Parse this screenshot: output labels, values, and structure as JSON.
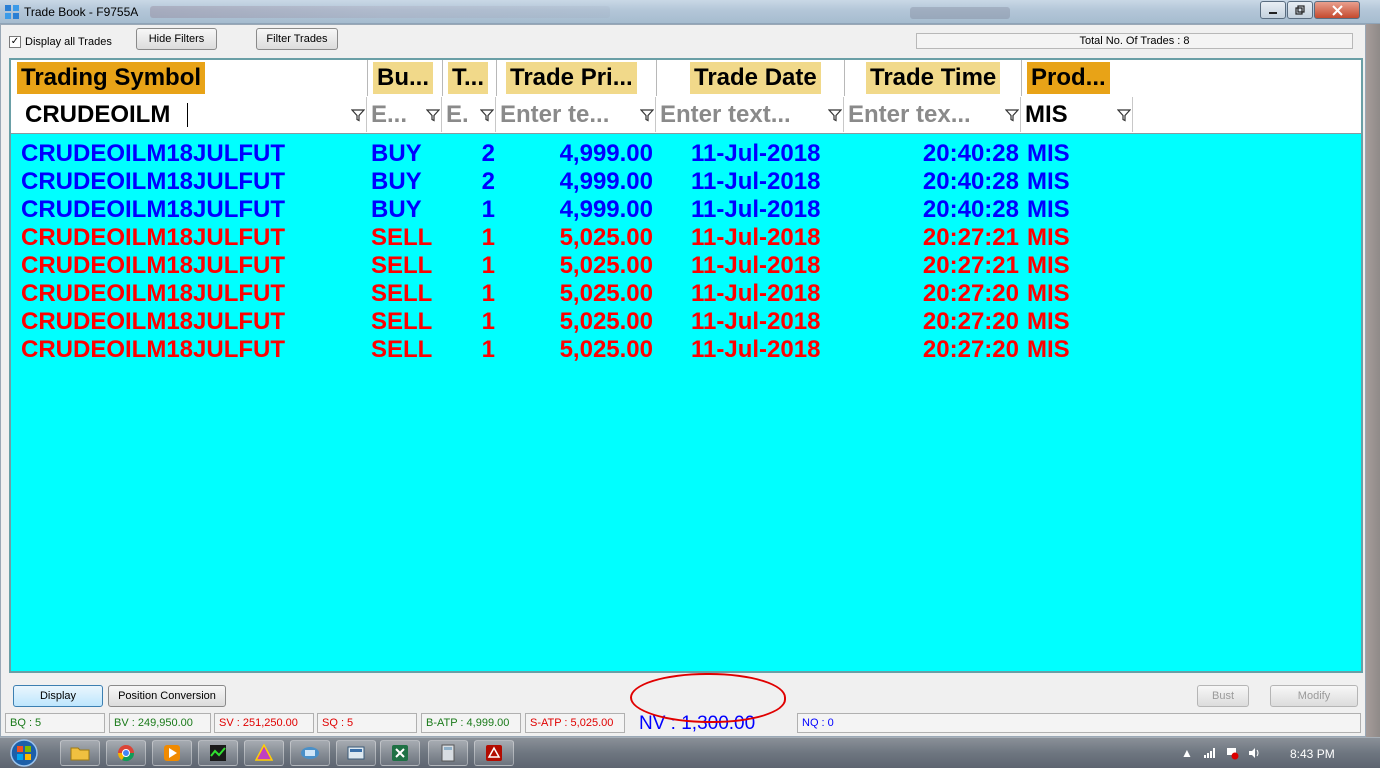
{
  "window": {
    "title": "Trade Book - F9755A"
  },
  "toolbar": {
    "display_all_label": "Display all Trades",
    "display_all_checked": true,
    "hide_filters_label": "Hide Filters",
    "filter_trades_label": "Filter Trades",
    "total_trades": "Total No. Of Trades : 8"
  },
  "grid": {
    "columns": [
      {
        "key": "symbol",
        "header": "Trading Symbol",
        "filter": "CRUDEOILM",
        "filter_is_value": true
      },
      {
        "key": "side",
        "header": "Bu...",
        "filter": "E...",
        "filter_is_value": false
      },
      {
        "key": "qty",
        "header": "T...",
        "filter": "E.",
        "filter_is_value": false
      },
      {
        "key": "price",
        "header": "Trade Pri...",
        "filter": "Enter te...",
        "filter_is_value": false
      },
      {
        "key": "date",
        "header": "Trade Date",
        "filter": "Enter text...",
        "filter_is_value": false
      },
      {
        "key": "time",
        "header": "Trade Time",
        "filter": "Enter tex...",
        "filter_is_value": false
      },
      {
        "key": "product",
        "header": "Prod...",
        "filter": "MIS",
        "filter_is_value": true
      }
    ],
    "rows": [
      {
        "symbol": "CRUDEOILM18JULFUT",
        "side": "BUY",
        "qty": "2",
        "price": "4,999.00",
        "date": "11-Jul-2018",
        "time": "20:40:28",
        "product": "MIS",
        "color": "#0000ff"
      },
      {
        "symbol": "CRUDEOILM18JULFUT",
        "side": "BUY",
        "qty": "2",
        "price": "4,999.00",
        "date": "11-Jul-2018",
        "time": "20:40:28",
        "product": "MIS",
        "color": "#0000ff"
      },
      {
        "symbol": "CRUDEOILM18JULFUT",
        "side": "BUY",
        "qty": "1",
        "price": "4,999.00",
        "date": "11-Jul-2018",
        "time": "20:40:28",
        "product": "MIS",
        "color": "#0000ff"
      },
      {
        "symbol": "CRUDEOILM18JULFUT",
        "side": "SELL",
        "qty": "1",
        "price": "5,025.00",
        "date": "11-Jul-2018",
        "time": "20:27:21",
        "product": "MIS",
        "color": "#ff0000"
      },
      {
        "symbol": "CRUDEOILM18JULFUT",
        "side": "SELL",
        "qty": "1",
        "price": "5,025.00",
        "date": "11-Jul-2018",
        "time": "20:27:21",
        "product": "MIS",
        "color": "#ff0000"
      },
      {
        "symbol": "CRUDEOILM18JULFUT",
        "side": "SELL",
        "qty": "1",
        "price": "5,025.00",
        "date": "11-Jul-2018",
        "time": "20:27:20",
        "product": "MIS",
        "color": "#ff0000"
      },
      {
        "symbol": "CRUDEOILM18JULFUT",
        "side": "SELL",
        "qty": "1",
        "price": "5,025.00",
        "date": "11-Jul-2018",
        "time": "20:27:20",
        "product": "MIS",
        "color": "#ff0000"
      },
      {
        "symbol": "CRUDEOILM18JULFUT",
        "side": "SELL",
        "qty": "1",
        "price": "5,025.00",
        "date": "11-Jul-2018",
        "time": "20:27:20",
        "product": "MIS",
        "color": "#ff0000"
      }
    ]
  },
  "bottom": {
    "display_label": "Display",
    "position_conversion_label": "Position Conversion",
    "bust_label": "Bust",
    "modify_label": "Modify"
  },
  "status": {
    "bq": "BQ : 5",
    "bv": "BV : 249,950.00",
    "sv": "SV : 251,250.00",
    "sq": "SQ : 5",
    "batp": "B-ATP : 4,999.00",
    "satp": "S-ATP : 5,025.00",
    "nv": "NV : 1,300.00",
    "nq": "NQ : 0"
  },
  "taskbar": {
    "clock": "8:43 PM"
  },
  "colors": {
    "grid_bg": "#00ffff",
    "header_highlight": "#e8a317",
    "header_light": "#f1d98a",
    "buy": "#0000ff",
    "sell": "#ff0000",
    "status_green": "#1a7a1a",
    "status_red": "#e00000",
    "status_blue": "#0000ff"
  }
}
